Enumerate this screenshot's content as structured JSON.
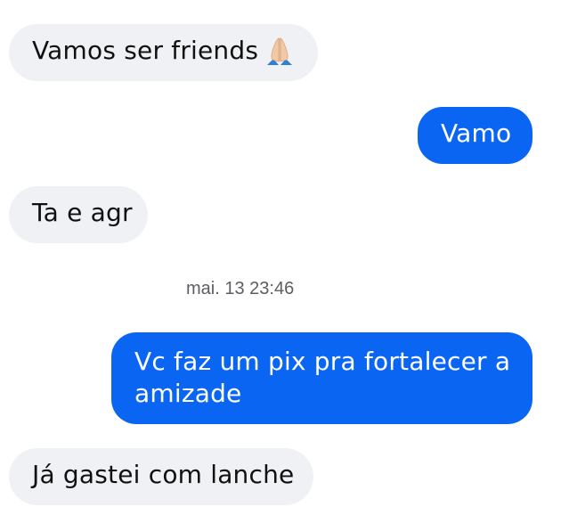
{
  "messages": [
    {
      "direction": "received",
      "text": "Vamos ser friends",
      "emoji": "folded-hands-icon"
    },
    {
      "direction": "sent",
      "text": "Vamo"
    },
    {
      "direction": "received",
      "text": "Ta e agr"
    },
    {
      "direction": "sent",
      "lines": [
        "Vc faz um pix pra fortalecer a",
        "amizade"
      ]
    },
    {
      "direction": "received",
      "text": "Já gastei com lanche"
    }
  ],
  "timestamp": "mai. 13 23:46",
  "colors": {
    "incoming_bubble": "#f0f1f5",
    "outgoing_bubble": "#0a66f2",
    "incoming_text": "#111111",
    "outgoing_text": "#ffffff",
    "timestamp_text": "#5b5e63"
  }
}
